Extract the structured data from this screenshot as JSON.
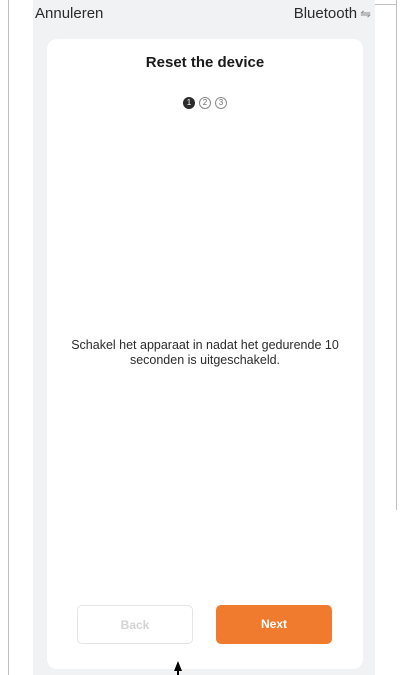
{
  "topbar": {
    "cancel_label": "Annuleren",
    "bluetooth_label": "Bluetooth",
    "bluetooth_icon": "⇋"
  },
  "card": {
    "title": "Reset the device",
    "steps": [
      "1",
      "2",
      "3"
    ],
    "active_step": 1,
    "instruction": "Schakel het apparaat in nadat het gedurende 10 seconden is uitgeschakeld."
  },
  "buttons": {
    "back_label": "Back",
    "next_label": "Next"
  },
  "colors": {
    "accent": "#f07a2e",
    "background": "#f1f2f4",
    "card": "#ffffff"
  },
  "icons": {
    "bluetooth": "swap-arrows-icon",
    "cursor": "mouse-pointer-icon"
  }
}
